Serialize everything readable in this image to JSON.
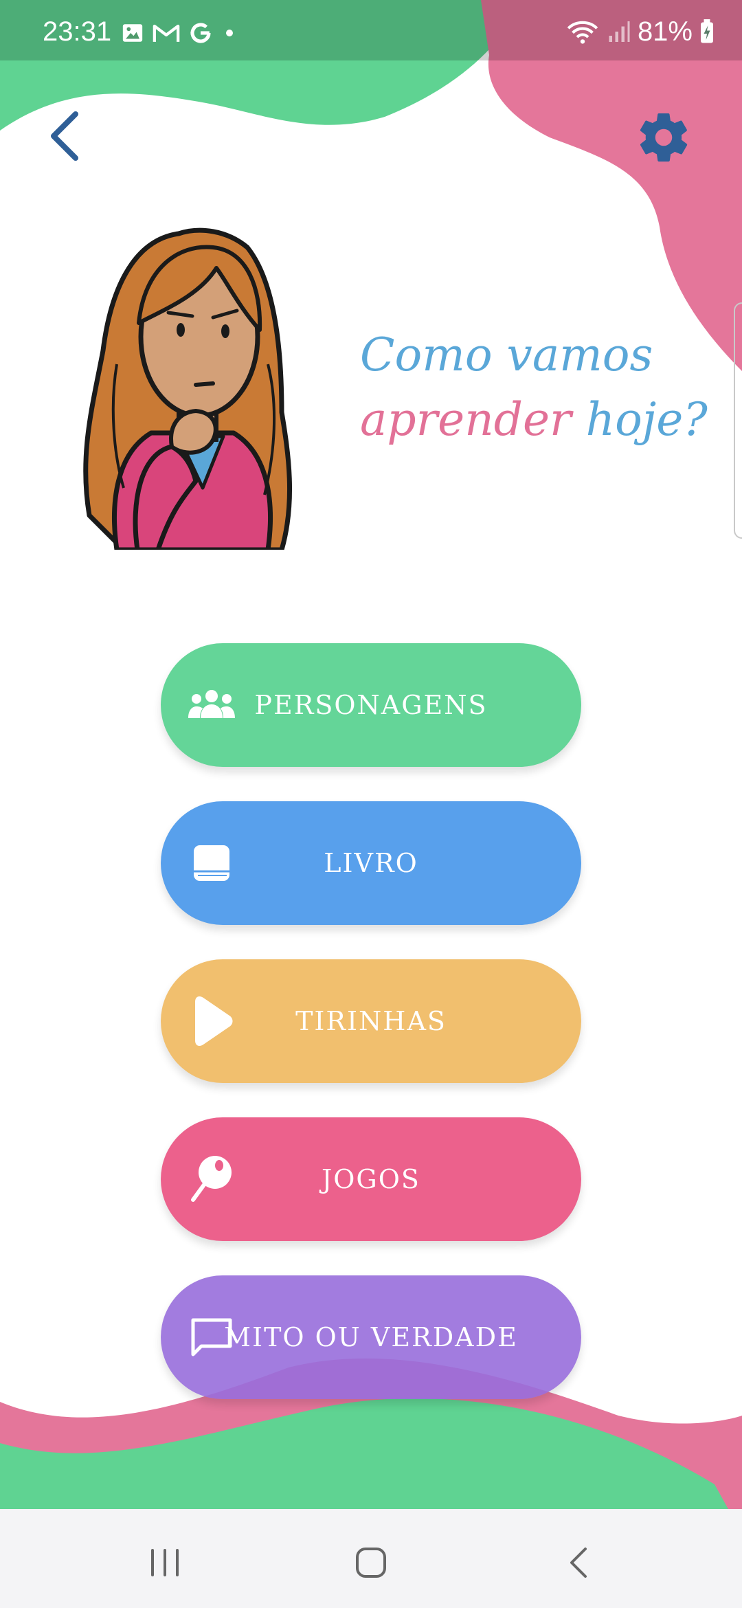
{
  "status_bar": {
    "time": "23:31",
    "battery": "81%",
    "left_icons": [
      "image-icon",
      "gmail-icon",
      "google-icon",
      "dot-icon"
    ],
    "right_icons": [
      "wifi-icon",
      "signal-icon",
      "battery-charging-icon"
    ]
  },
  "header": {
    "back_icon": "chevron-left-icon",
    "settings_icon": "gear-icon"
  },
  "headline": {
    "line1": "Como vamos",
    "line2_part1": "aprender",
    "line2_part2": "hoje?"
  },
  "menu": {
    "personagens": {
      "label": "PERSONAGENS",
      "icon": "people-icon",
      "color": "#64d598"
    },
    "livro": {
      "label": "LIVRO",
      "icon": "book-icon",
      "color": "#58a0ec"
    },
    "tirinhas": {
      "label": "TIRINHAS",
      "icon": "play-icon",
      "color": "#f1bf6e"
    },
    "jogos": {
      "label": "JOGOS",
      "icon": "lollipop-icon",
      "color": "#ec618c"
    },
    "mito": {
      "label": "MITO OU VERDADE",
      "icon": "chat-bubble-icon",
      "color": "#986edc"
    }
  },
  "colors": {
    "accent_green": "#5fd392",
    "accent_pink": "#e4769a",
    "headline_blue": "#5aa7d8",
    "headline_pink": "#e27197",
    "icon_blue": "#2f5f97"
  },
  "nav_bar": {
    "icons": [
      "recents-icon",
      "home-icon",
      "back-icon"
    ]
  }
}
